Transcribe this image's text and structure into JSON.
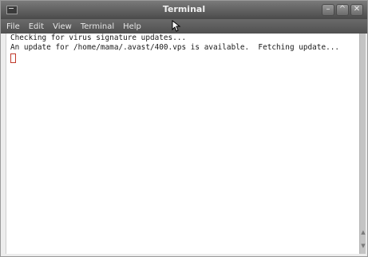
{
  "window": {
    "title": "Terminal"
  },
  "menu": {
    "items": [
      "File",
      "Edit",
      "View",
      "Terminal",
      "Help"
    ]
  },
  "terminal": {
    "lines": [
      "Checking for virus signature updates...",
      "An update for /home/mama/.avast/400.vps is available.  Fetching update..."
    ]
  },
  "icons": {
    "window_icon": "terminal-window-icon",
    "minimize": "minimize-icon",
    "maximize": "maximize-icon",
    "close": "close-icon",
    "pointer": "mouse-pointer-icon"
  },
  "colors": {
    "titlebar": "#5a5a5a",
    "menubar": "#5c5c5c",
    "terminal_bg": "#ffffff",
    "cursor": "#c0392b"
  }
}
